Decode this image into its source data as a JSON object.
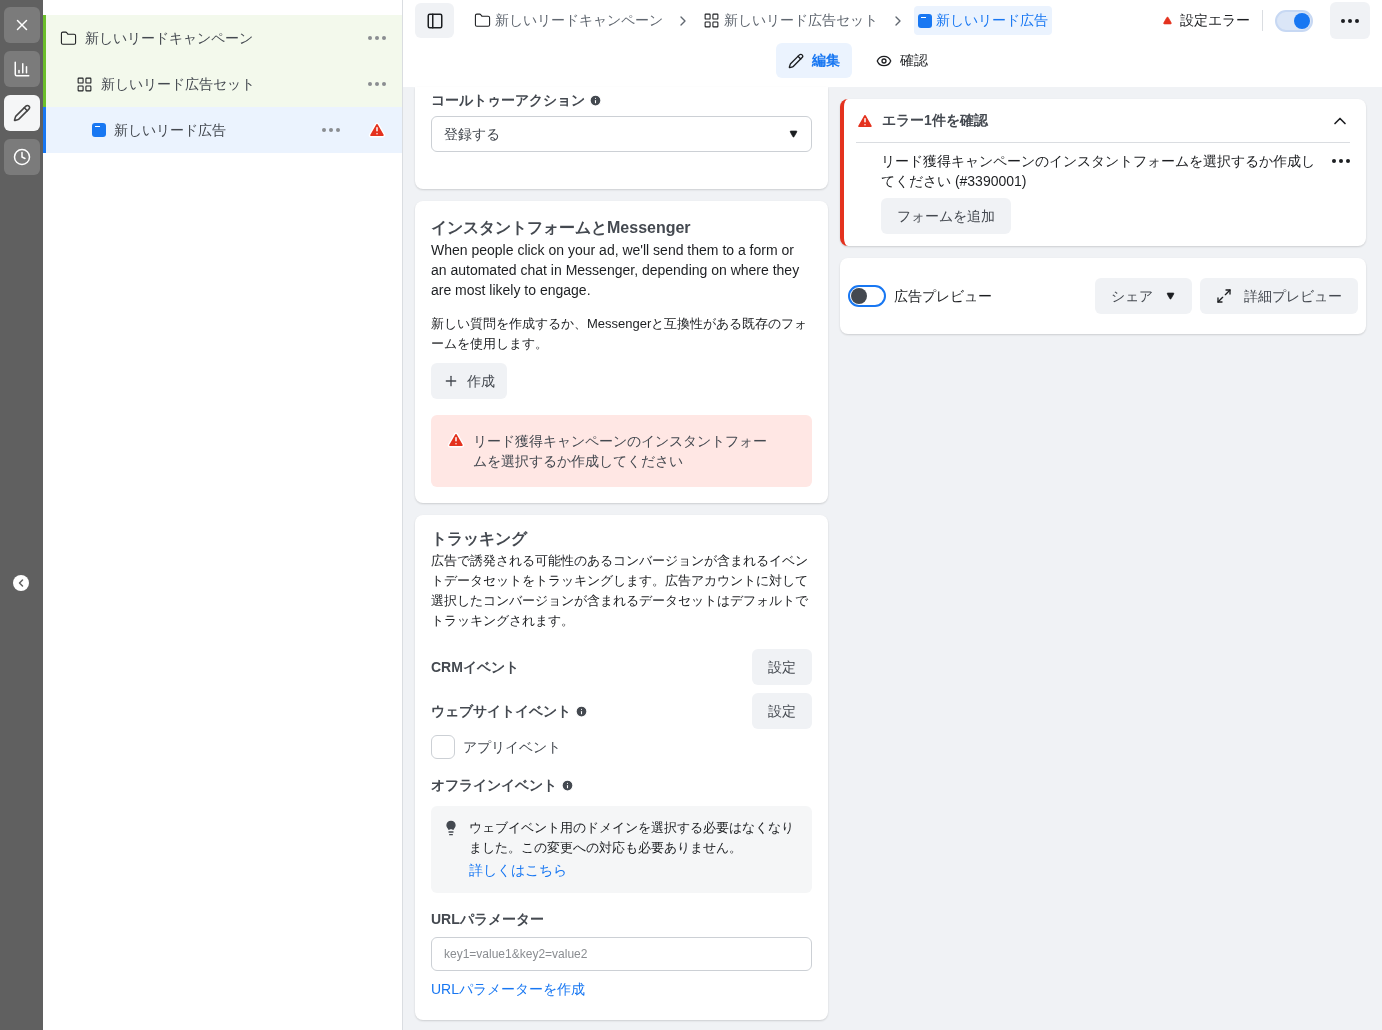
{
  "rail": [
    {
      "kind": "close",
      "selected": false
    },
    {
      "kind": "chart",
      "selected": false
    },
    {
      "kind": "edit",
      "selected": true
    },
    {
      "kind": "history",
      "selected": false
    }
  ],
  "tree": [
    {
      "kind": "campaign",
      "label": "新しいリードキャンペーン",
      "selected": false,
      "error": false,
      "children": [
        {
          "kind": "adset",
          "label": "新しいリード広告セット",
          "selected": false,
          "error": false,
          "children": [
            {
              "kind": "ad",
              "label": "新しいリード広告",
              "selected": true,
              "error": true
            }
          ]
        }
      ]
    }
  ],
  "breadcrumbs": [
    {
      "kind": "campaign",
      "label": "新しいリードキャンペーン",
      "selected": false
    },
    {
      "kind": "adset",
      "label": "新しいリード広告セット",
      "selected": false
    },
    {
      "kind": "ad",
      "label": "新しいリード広告",
      "selected": true
    }
  ],
  "status": {
    "label": "設定エラー",
    "toggle_on": true
  },
  "tabs": [
    {
      "kind": "edit",
      "label": "編集",
      "selected": true
    },
    {
      "kind": "review",
      "label": "確認",
      "selected": false
    }
  ],
  "cta": {
    "label": "コールトゥーアクション",
    "value": "登録する"
  },
  "instant_form": {
    "title": "インスタントフォームとMessenger",
    "description": "When people click on your ad, we'll send them to a form or an automated chat in Messenger, depending on where they are most likely to engage.",
    "note": "新しい質問を作成するか、Messengerと互換性がある既存のフォームを使用します。",
    "create_button": "作成",
    "error": "リード獲得キャンペーンのインスタントフォームを選択するか作成してください"
  },
  "tracking": {
    "title": "トラッキング",
    "description": "広告で誘発される可能性のあるコンバージョンが含まれるイベントデータセットをトラッキングします。広告アカウントに対して選択したコンバージョンが含まれるデータセットはデフォルトでトラッキングされます。",
    "crm_label": "CRMイベント",
    "crm_button": "設定",
    "website_label": "ウェブサイトイベント",
    "website_button": "設定",
    "app_event": {
      "label": "アプリイベント",
      "checked": false
    },
    "offline_label": "オフラインイベント",
    "tip": {
      "text": "ウェブイベント用のドメインを選択する必要はなくなりました。この変更への対応も必要ありません。",
      "link": "詳しくはこちら"
    },
    "url_label": "URLパラメーター",
    "url_placeholder": "key1=value1&key2=value2",
    "url_link": "URLパラメーターを作成"
  },
  "error_panel": {
    "title": "エラー1件を確認",
    "expanded": true,
    "message": "リード獲得キャンペーンのインスタントフォームを選択するか作成してください (#3390001)",
    "button": "フォームを追加"
  },
  "preview": {
    "label": "広告プレビュー",
    "toggle_on": false,
    "share_button": "シェア",
    "full_button": "詳細プレビュー"
  }
}
